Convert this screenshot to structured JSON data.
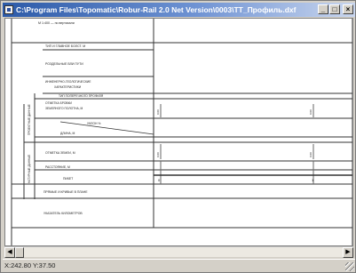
{
  "window": {
    "title": "C:\\Program Files\\Topomatic\\Robur-Rail 2.0 Net Version\\0003\\TT_Профиль.dxf",
    "minimize_glyph": "_",
    "maximize_glyph": "□",
    "close_glyph": "×"
  },
  "profile": {
    "scale_note": "М 1:400 — по вертикали",
    "rows": {
      "track_type": "ТИП И ГЛАВНОЕ БОЛСТ. М",
      "subgrade": "РОЗДЕЛЬНЫЕ ВЛИ ПУТИ",
      "geology_1": "ИНЖЕНЕРНО-ГЕОЛОГИЧЕСКИЕ",
      "geology_2": "ХАРАКТЕРИСТИКИ",
      "cross_profile": "ТИП ПОПЕРЕЧНОГО ПРОФИЛЯ",
      "design_elev_1": "ОТМЕТКА БРОВКИ",
      "design_elev_2": "ЗЕМЛЯНОГО ПОЛОТНА, М",
      "slope": "УКЛОН %",
      "length": "ДЛИНА, М",
      "ground_elev": "ОТМЕТКА ЗЕМЛИ, М",
      "distance": "РАССТОЯНИЕ, М",
      "picket": "ПИКЕТ",
      "plan": "ПРЯМЫЕ И КРИВЫЕ В ПЛАНЕ",
      "km": "УКАЗАТЕЛЬ КИЛОМЕТРОВ"
    },
    "group_design": "ПРОЕКТНЫЕ ДАННЫЕ",
    "group_existing": "НАТУРНЫЕ ДАННЫЕ",
    "design_val_left": "0.00",
    "design_val_right": "0.00",
    "ground_val_left": "0.00",
    "ground_val_right": "0.00",
    "picket_0": "0",
    "picket_1": "1"
  },
  "statusbar": {
    "coords": "X:242.80  Y:37.50"
  }
}
